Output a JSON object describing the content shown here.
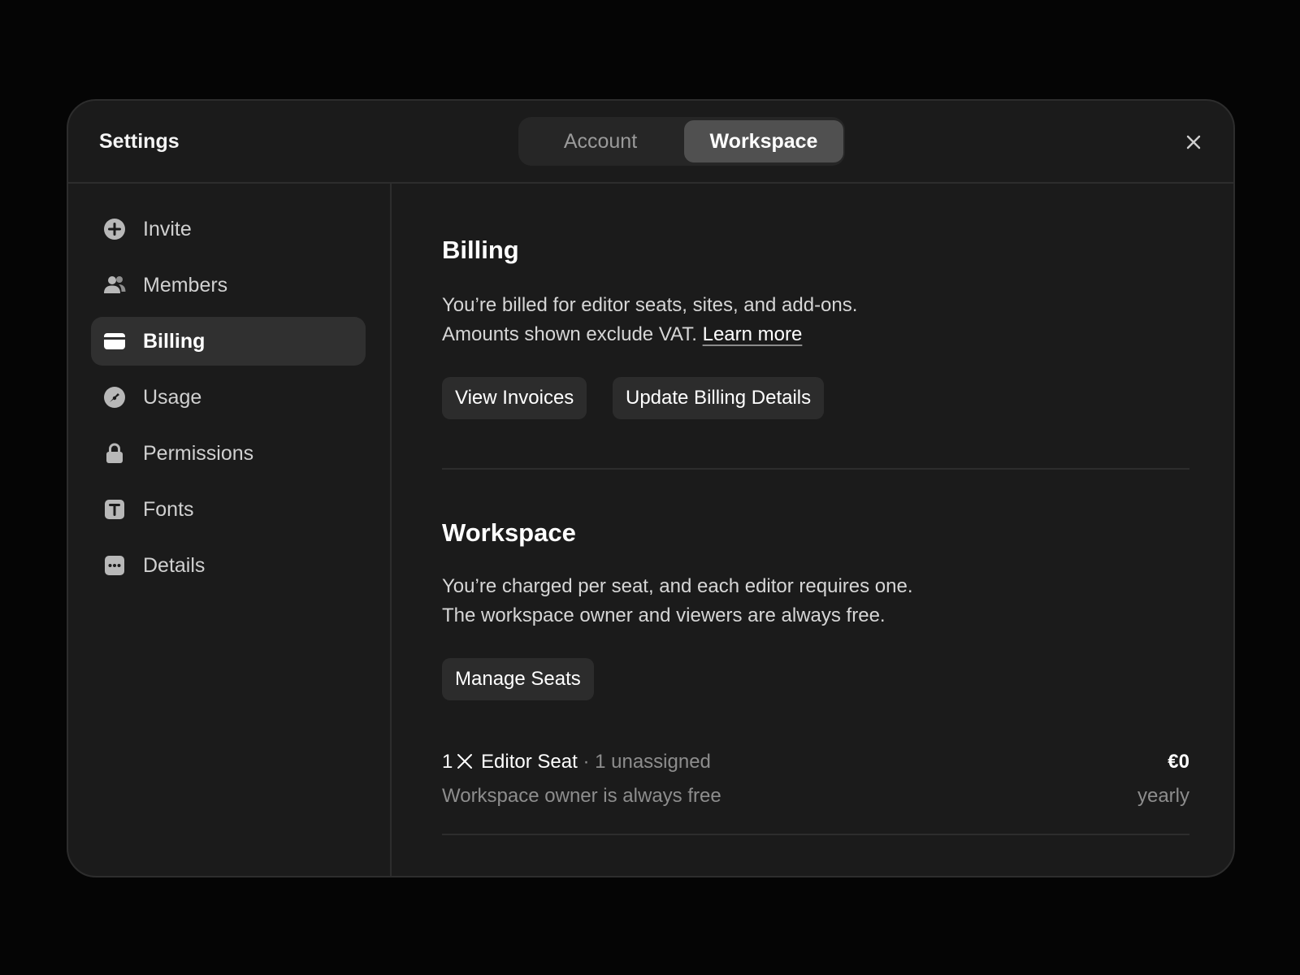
{
  "header": {
    "title": "Settings",
    "tabs": [
      {
        "label": "Account",
        "active": false
      },
      {
        "label": "Workspace",
        "active": true
      }
    ],
    "close_icon": "close-icon"
  },
  "sidebar": {
    "items": [
      {
        "label": "Invite",
        "icon": "plus-circle-icon",
        "active": false
      },
      {
        "label": "Members",
        "icon": "members-icon",
        "active": false
      },
      {
        "label": "Billing",
        "icon": "card-icon",
        "active": true
      },
      {
        "label": "Usage",
        "icon": "gauge-icon",
        "active": false
      },
      {
        "label": "Permissions",
        "icon": "lock-icon",
        "active": false
      },
      {
        "label": "Fonts",
        "icon": "font-icon",
        "active": false
      },
      {
        "label": "Details",
        "icon": "more-icon",
        "active": false
      }
    ]
  },
  "billing": {
    "title": "Billing",
    "line1": "You’re billed for editor seats, sites, and add-ons.",
    "line2": "Amounts shown exclude VAT.",
    "link": "Learn more",
    "view_invoices": "View Invoices",
    "update_details": "Update Billing Details"
  },
  "workspace": {
    "title": "Workspace",
    "line1": "You’re charged per seat, and each editor requires one.",
    "line2": "The workspace owner and viewers are always free.",
    "manage_seats": "Manage Seats",
    "seat": {
      "quantity": "1",
      "name": "Editor Seat",
      "separator": "·",
      "status": "1 unassigned",
      "note": "Workspace owner is always free",
      "price": "€0",
      "period": "yearly"
    }
  },
  "colors": {
    "page_background": "#050505",
    "modal_background": "#1b1b1b",
    "active_tab": "#505050",
    "active_nav": "#303030",
    "button_background": "#2c2c2c"
  }
}
